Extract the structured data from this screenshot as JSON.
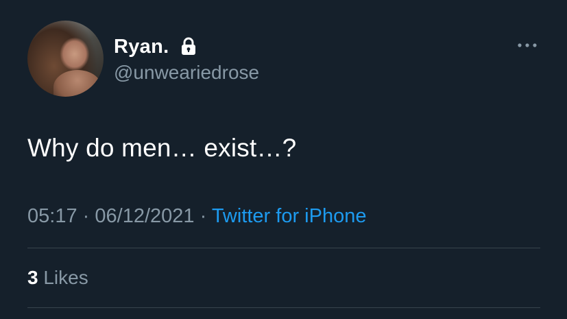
{
  "author": {
    "display_name": "Ryan.",
    "handle": "@unweariedrose",
    "protected": true,
    "avatar_icon": "profile-photo"
  },
  "tweet": {
    "text": "Why do men… exist…?",
    "time": "05:17",
    "separator": "·",
    "date": "06/12/2021",
    "source": "Twitter for iPhone"
  },
  "stats": {
    "likes_count": "3",
    "likes_label": "Likes"
  },
  "colors": {
    "background": "#15202b",
    "primary_text": "#ffffff",
    "secondary_text": "#8899a6",
    "accent": "#1d9bf0",
    "divider": "#38444d"
  }
}
